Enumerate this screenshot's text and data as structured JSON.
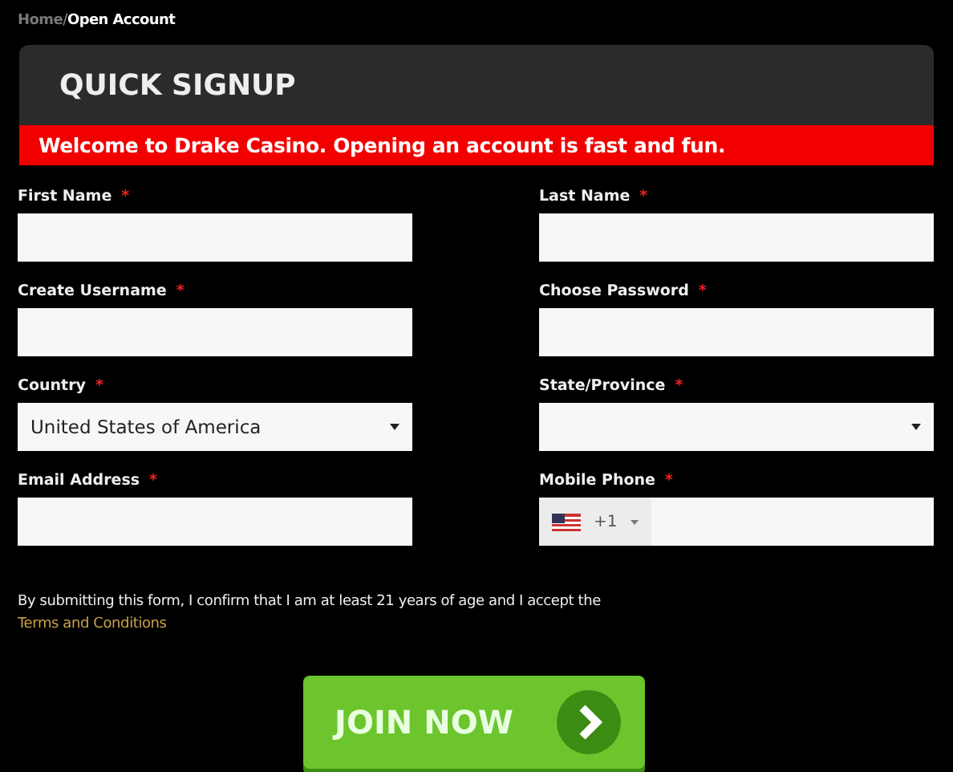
{
  "breadcrumb": [
    {
      "label": "Home",
      "current": false
    },
    {
      "label": "Open Account",
      "current": true
    }
  ],
  "breadcrumb_separator": "/",
  "panel": {
    "title": "QUICK SIGNUP",
    "banner": "Welcome to Drake Casino. Opening an account is fast and fun."
  },
  "fields": [
    {
      "label": "First Name",
      "required": "*",
      "kind": "text"
    },
    {
      "label": "Last Name",
      "required": "*",
      "kind": "text"
    },
    {
      "label": "Create Username",
      "required": "*",
      "kind": "text"
    },
    {
      "label": "Choose Password",
      "required": "*",
      "kind": "text"
    },
    {
      "label": "Country",
      "required": "*",
      "kind": "select",
      "value": "United States of America"
    },
    {
      "label": "State/Province",
      "required": "*",
      "kind": "select"
    },
    {
      "label": "Email Address",
      "required": "*",
      "kind": "text"
    },
    {
      "label": "Mobile Phone",
      "required": "*",
      "kind": "phone",
      "dial_code": "+1"
    }
  ],
  "consent": {
    "text": "By submitting this form, I confirm that I am at least 21 years of age and I accept the",
    "link": "Terms and Conditions"
  },
  "submit": {
    "label": "JOIN NOW"
  }
}
